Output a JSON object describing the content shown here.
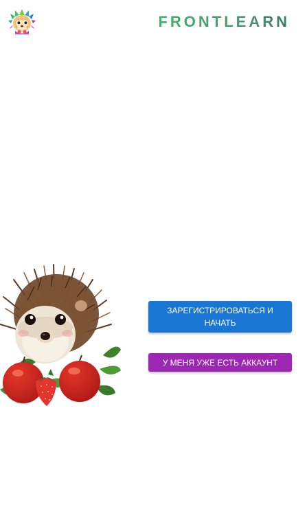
{
  "header": {
    "brand": "FRONTLEARN",
    "logo_icon": "hedgehog-logo-icon"
  },
  "hero": {
    "image_icon": "hedgehog-with-strawberries-illustration"
  },
  "actions": {
    "register_label": "ЗАРЕГИСТРИРОВАТЬСЯ И НАЧАТЬ",
    "login_label": "У МЕНЯ УЖЕ ЕСТЬ АККАУНТ"
  },
  "colors": {
    "primary": "#1976d2",
    "secondary": "#9c27b0",
    "brand_green": "#3fb06b",
    "background": "#ffffff"
  }
}
